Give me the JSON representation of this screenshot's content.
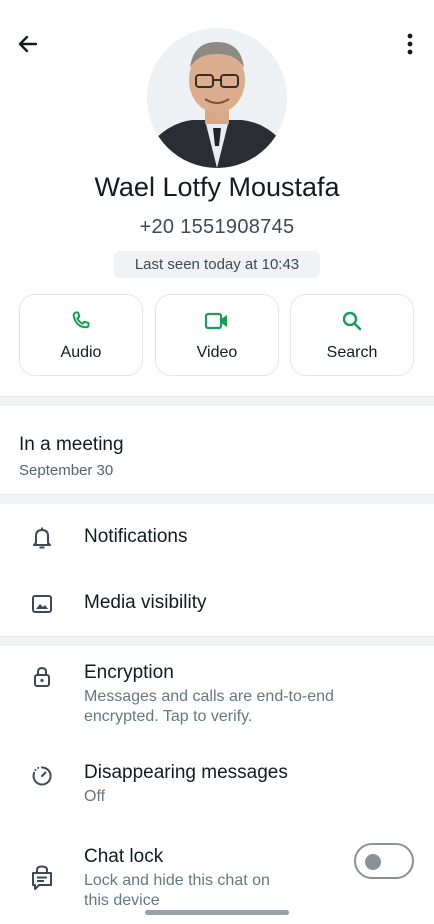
{
  "header": {
    "back_icon": "arrow-left-icon",
    "more_icon": "more-vertical-icon"
  },
  "contact": {
    "name": "Wael Lotfy Moustafa",
    "phone": "+20 1551908745",
    "last_seen": "Last seen today at 10:43"
  },
  "actions": [
    {
      "label": "Audio",
      "icon": "phone-icon"
    },
    {
      "label": "Video",
      "icon": "video-camera-icon"
    },
    {
      "label": "Search",
      "icon": "search-icon"
    }
  ],
  "about": {
    "text": "In a meeting",
    "date": "September 30"
  },
  "settings": {
    "notifications": {
      "title": "Notifications",
      "icon": "bell-icon"
    },
    "media_visibility": {
      "title": "Media visibility",
      "icon": "image-icon"
    },
    "encryption": {
      "title": "Encryption",
      "subtitle_line1": "Messages and calls are end-to-end",
      "subtitle_line2": "encrypted. Tap to verify.",
      "icon": "lock-icon"
    },
    "disappearing": {
      "title": "Disappearing messages",
      "subtitle": "Off",
      "icon": "timer-icon"
    },
    "chat_lock": {
      "title": "Chat lock",
      "subtitle_line1": "Lock and hide this chat on",
      "subtitle_line2": "this device",
      "icon": "chat-lock-icon",
      "enabled": false
    }
  },
  "colors": {
    "accent": "#1c9d55",
    "text_primary": "#111b21",
    "text_secondary": "#667781"
  }
}
